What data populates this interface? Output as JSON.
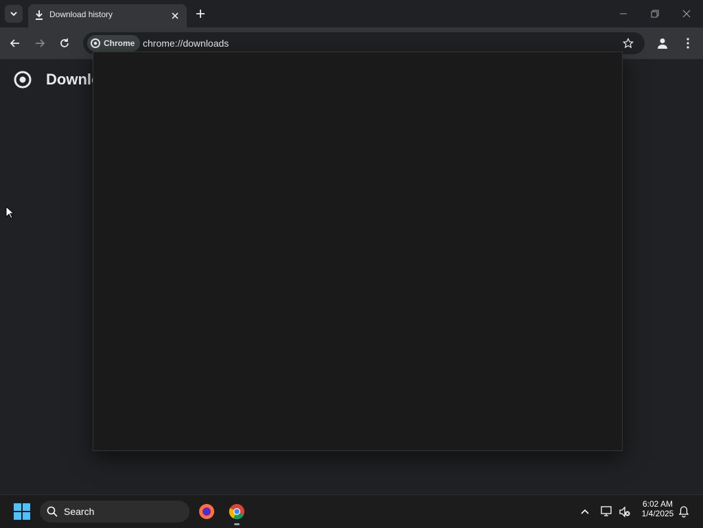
{
  "browser": {
    "tab": {
      "title": "Download history"
    },
    "omnibox": {
      "chip_label": "Chrome",
      "url": "chrome://downloads"
    }
  },
  "page": {
    "title": "Downlo"
  },
  "taskbar": {
    "search_placeholder": "Search",
    "clock": {
      "time": "6:02 AM",
      "date": "1/4/2025"
    }
  },
  "icons": [
    "tab-search-icon",
    "download-icon",
    "close-icon",
    "new-tab-icon",
    "minimize-icon",
    "restore-icon",
    "window-close-icon",
    "back-icon",
    "forward-icon",
    "reload-icon",
    "chrome-logo-icon",
    "bookmark-star-icon",
    "profile-icon",
    "menu-icon",
    "windows-start-icon",
    "search-icon",
    "firefox-icon",
    "chrome-icon",
    "chevron-up-icon",
    "network-icon",
    "volume-muted-icon",
    "notification-bell-icon",
    "cursor-icon"
  ],
  "colors": {
    "background": "#202124",
    "toolbar": "#35363a",
    "popup": "#1a1a1a",
    "taskbar": "#1c1c1c"
  }
}
